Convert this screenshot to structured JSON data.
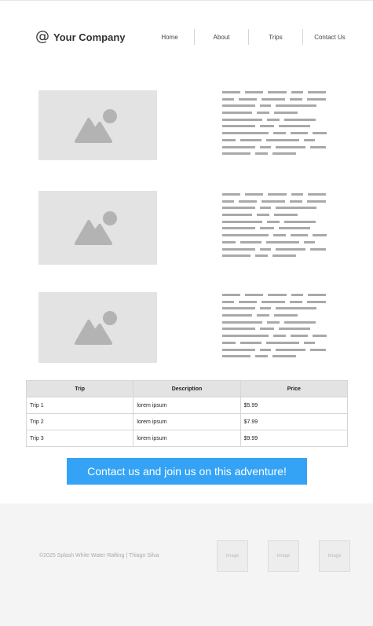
{
  "header": {
    "logo_icon": "@",
    "company_name": "Your Company",
    "nav": [
      "Home",
      "About",
      "Trips",
      "Contact Us"
    ]
  },
  "content_rows": [
    {
      "image": "image-placeholder-icon"
    },
    {
      "image": "image-placeholder-icon"
    },
    {
      "image": "image-placeholder-icon"
    }
  ],
  "trips_table": {
    "headers": [
      "Trip",
      "Description",
      "Price"
    ],
    "rows": [
      [
        "Trip 1",
        "lorem ipsum",
        "$5.99"
      ],
      [
        "Trip 2",
        "lorem ipsum",
        "$7.99"
      ],
      [
        "Trip 3",
        "lorem ipsum",
        "$9.99"
      ]
    ]
  },
  "cta": {
    "label": "Contact us and join us on this adventure!"
  },
  "footer": {
    "copyright": "©2025 Splash White Water Rafting | Thiago Silva",
    "images": [
      "Image",
      "Image",
      "Image"
    ]
  },
  "colors": {
    "accent": "#35a3f5",
    "placeholder_bg": "#e3e3e3",
    "placeholder_icon": "#b3b3b3",
    "footer_bg": "#f4f4f4"
  }
}
